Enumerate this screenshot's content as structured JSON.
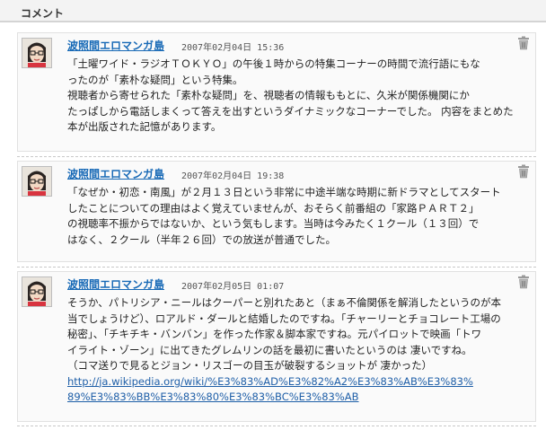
{
  "section": {
    "title": "コメント"
  },
  "comments": [
    {
      "author": "波照間エロマンガ島",
      "date": "2007年02月04日 15:36",
      "lines": [
        "「土曜ワイド・ラジオＴＯＫＹＯ」の午後１時からの特集コーナーの時間で流行語にもな",
        "ったのが「素朴な疑問」という特集。",
        "視聴者から寄せられた「素朴な疑問」を、視聴者の情報ももとに、久米が関係機関にか",
        "たっぱしから電話しまくって答えを出すというダイナミックなコーナーでした。 内容をまとめた",
        "本が出版された記憶があります。"
      ]
    },
    {
      "author": "波照間エロマンガ島",
      "date": "2007年02月04日 19:38",
      "lines": [
        "「なぜか・初恋・南風」が２月１３日という非常に中途半端な時期に新ドラマとしてスタート",
        "したことについての理由はよく覚えていませんが、おそらく前番組の「家路ＰＡＲＴ２」",
        "の視聴率不振からではないか、という気もします。当時は今みたく１クール（１３回）で",
        "はなく、２クール（半年２６回）での放送が普通でした。"
      ]
    },
    {
      "author": "波照間エロマンガ島",
      "date": "2007年02月05日 01:07",
      "lines": [
        "そうか、パトリシア・ニールはクーパーと別れたあと（まぁ不倫関係を解消したというのが本",
        "当でしょうけど）、ロアルド・ダールと結婚したのですね。「チャーリーとチョコレート工場の",
        "秘密」、「チキチキ・バンバン」を作った作家＆脚本家ですね。元パイロットで映画「トワ",
        "イライト・ゾーン」に出てきたグレムリンの話を最初に書いたというのは 凄いですね。",
        "（コマ送りで見るとジョン・リスゴーの目玉が破裂するショットが 凄かった）"
      ],
      "link_lines": [
        "http://ja.wikipedia.org/wiki/%E3%83%AD%E3%82%A2%E3%83%AB%E3%83%",
        "89%E3%83%BB%E3%83%80%E3%83%BC%E3%83%AB"
      ]
    }
  ]
}
